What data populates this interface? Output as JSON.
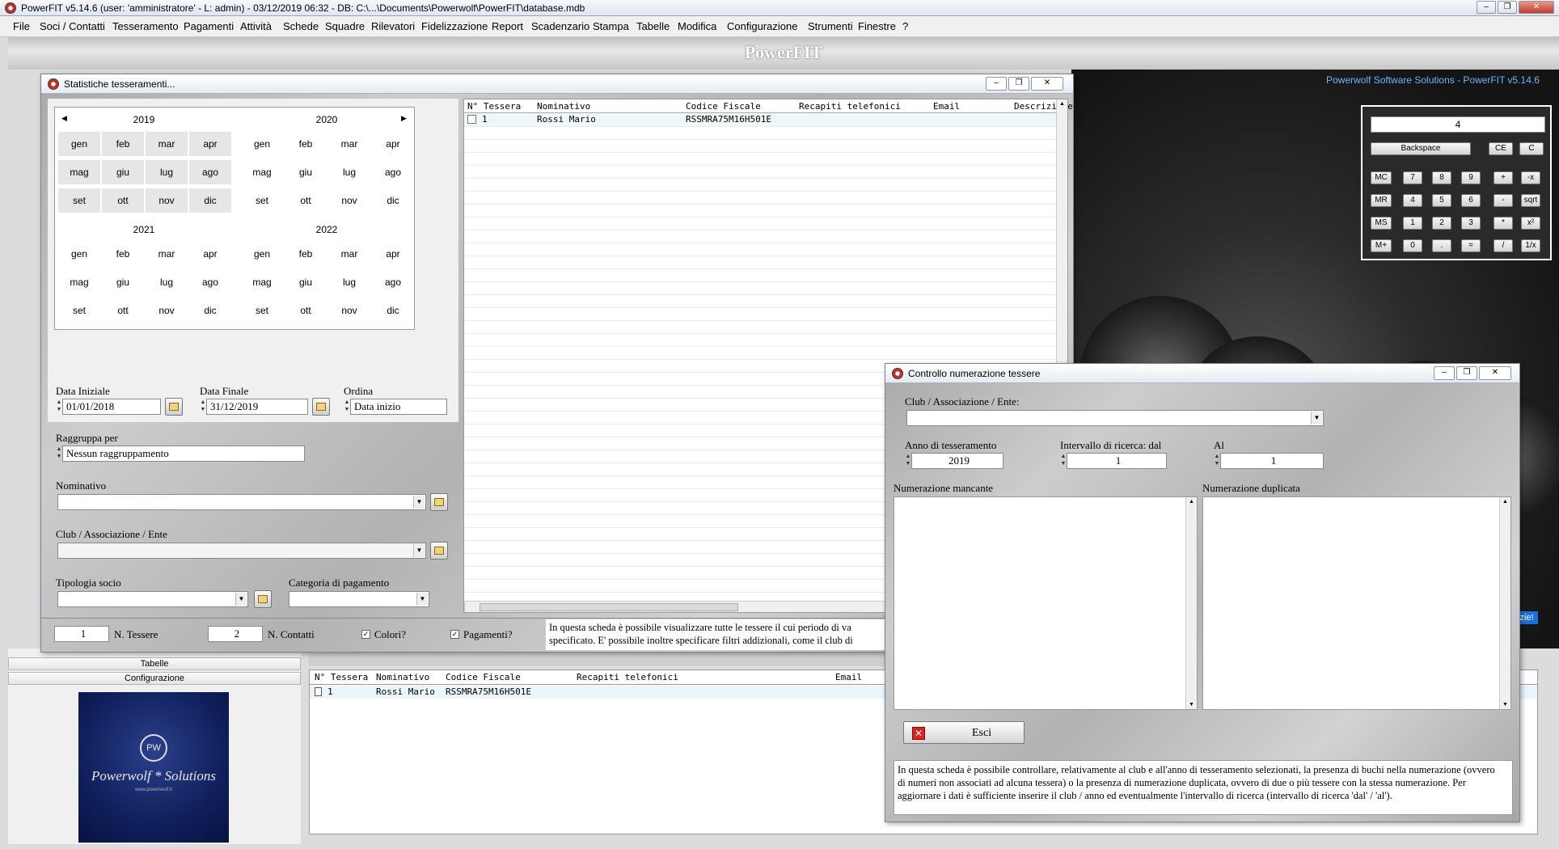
{
  "window": {
    "title": "PowerFIT v5.14.6  (user: 'amministratore'  - L: admin) - 03/12/2019 06:32 - DB: C:\\...\\Documents\\Powerwolf\\PowerFIT\\database.mdb"
  },
  "menu": [
    "File",
    "Soci / Contatti",
    "Tesseramento",
    "Pagamenti",
    "Attività",
    "Schede",
    "Squadre",
    "Rilevatori",
    "Fidelizzazione",
    "Report",
    "Scadenzario",
    "Stampa",
    "Tabelle",
    "Modifica",
    "Configurazione",
    "Strumenti",
    "Finestre",
    "?"
  ],
  "banner": "PowerFIT",
  "powerwolf_link": "Powerwolf Software Solutions - PowerFIT v5.14.6",
  "calculator": {
    "display": "4",
    "top": [
      "Backspace",
      "CE",
      "C"
    ],
    "rows": [
      [
        "MC",
        "7",
        "8",
        "9",
        "+",
        "-x"
      ],
      [
        "MR",
        "4",
        "5",
        "6",
        "-",
        "sqrt"
      ],
      [
        "MS",
        "1",
        "2",
        "3",
        "*",
        "x²"
      ],
      [
        "M+",
        "0",
        ".",
        "=",
        "/",
        "1/x"
      ]
    ]
  },
  "stats": {
    "title": "Statistiche tesseramenti...",
    "years": [
      "2019",
      "2020",
      "2021",
      "2022"
    ],
    "months": [
      "gen",
      "feb",
      "mar",
      "apr",
      "mag",
      "giu",
      "lug",
      "ago",
      "set",
      "ott",
      "nov",
      "dic"
    ],
    "data_iniziale_label": "Data Iniziale",
    "data_iniziale": "01/01/2018",
    "data_finale_label": "Data Finale",
    "data_finale": "31/12/2019",
    "ordina_label": "Ordina",
    "ordina": "Data inizio",
    "raggruppa_label": "Raggruppa per",
    "raggruppa": "Nessun raggruppamento",
    "nominativo_label": "Nominativo",
    "club_label": "Club / Associazione / Ente",
    "tipologia_label": "Tipologia socio",
    "categoria_label": "Categoria di pagamento",
    "n_tessere": "1",
    "n_tessere_label": "N. Tessere",
    "n_contatti": "2",
    "n_contatti_label": "N. Contatti",
    "colori_label": "Colori?",
    "pagamenti_label": "Pagamenti?",
    "info": "In questa scheda è possibile visualizzare tutte le tessere il cui periodo di va specificato. E' possibile inoltre specificare filtri addizionali, come il club di",
    "columns": [
      "N° Tessera",
      "Nominativo",
      "Codice Fiscale",
      "Recapiti telefonici",
      "Email",
      "Descrizione"
    ],
    "rows": [
      {
        "num": "1",
        "nome": "Rossi Mario",
        "cf": "RSSMRA75M16H501E"
      }
    ]
  },
  "left_panel": {
    "tabelle": "Tabelle",
    "configurazione": "Configurazione",
    "logo_text": "Powerwolf * Solutions",
    "logo_badge": "PW",
    "logo_small": "www.powerwolf.it"
  },
  "bottom_grid": {
    "columns": [
      "N° Tessera",
      "Nominativo",
      "Codice Fiscale",
      "Recapiti telefonici",
      "Email"
    ],
    "rows": [
      {
        "num": "1",
        "nome": "Rossi Mario",
        "cf": "RSSMRA75M16H501E"
      }
    ]
  },
  "controllo": {
    "title": "Controllo numerazione tessere",
    "club_label": "Club / Associazione / Ente:",
    "anno_label": "Anno di tesseramento",
    "anno": "2019",
    "dal_label": "Intervallo di ricerca: dal",
    "dal": "1",
    "al_label": "Al",
    "al": "1",
    "mancante_label": "Numerazione mancante",
    "duplicata_label": "Numerazione duplicata",
    "esci": "Esci",
    "info": "In questa scheda è possibile controllare, relativamente al club e all'anno di tesseramento selezionati, la presenza di buchi nella numerazione (ovvero di numeri non associati ad alcuna tessera) o la presenza di numerazione duplicata, ovvero di due o più tessere con la stessa numerazione. Per aggiornare i dati è sufficiente inserire il club / anno ed eventualmente l'intervallo di ricerca (intervallo di ricerca 'dal' / 'al')."
  },
  "partial_right_btn": "zie!"
}
